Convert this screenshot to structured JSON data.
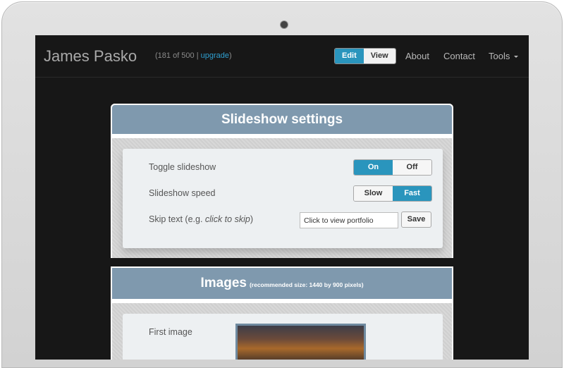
{
  "header": {
    "brand": "James Pasko",
    "quota_prefix": "(181 of 500 | ",
    "quota_link": "upgrade",
    "quota_suffix": ")",
    "edit_label": "Edit",
    "view_label": "View",
    "nav": [
      "About",
      "Contact",
      "Tools"
    ]
  },
  "slideshow": {
    "title": "Slideshow settings",
    "toggle_label": "Toggle slideshow",
    "toggle_on": "On",
    "toggle_off": "Off",
    "toggle_selected": "On",
    "speed_label": "Slideshow speed",
    "speed_slow": "Slow",
    "speed_fast": "Fast",
    "speed_selected": "Fast",
    "skip_label_prefix": "Skip text (e.g. ",
    "skip_label_italic": "click to skip",
    "skip_label_suffix": ")",
    "skip_value": "Click to view portfolio",
    "save_label": "Save"
  },
  "images": {
    "title": "Images",
    "note": "(recommended size: 1440 by 900 pixels)",
    "first_image_label": "First image"
  },
  "colors": {
    "accent": "#2a95bd",
    "panel_header": "#7f99ae",
    "screen_bg": "#171717"
  }
}
